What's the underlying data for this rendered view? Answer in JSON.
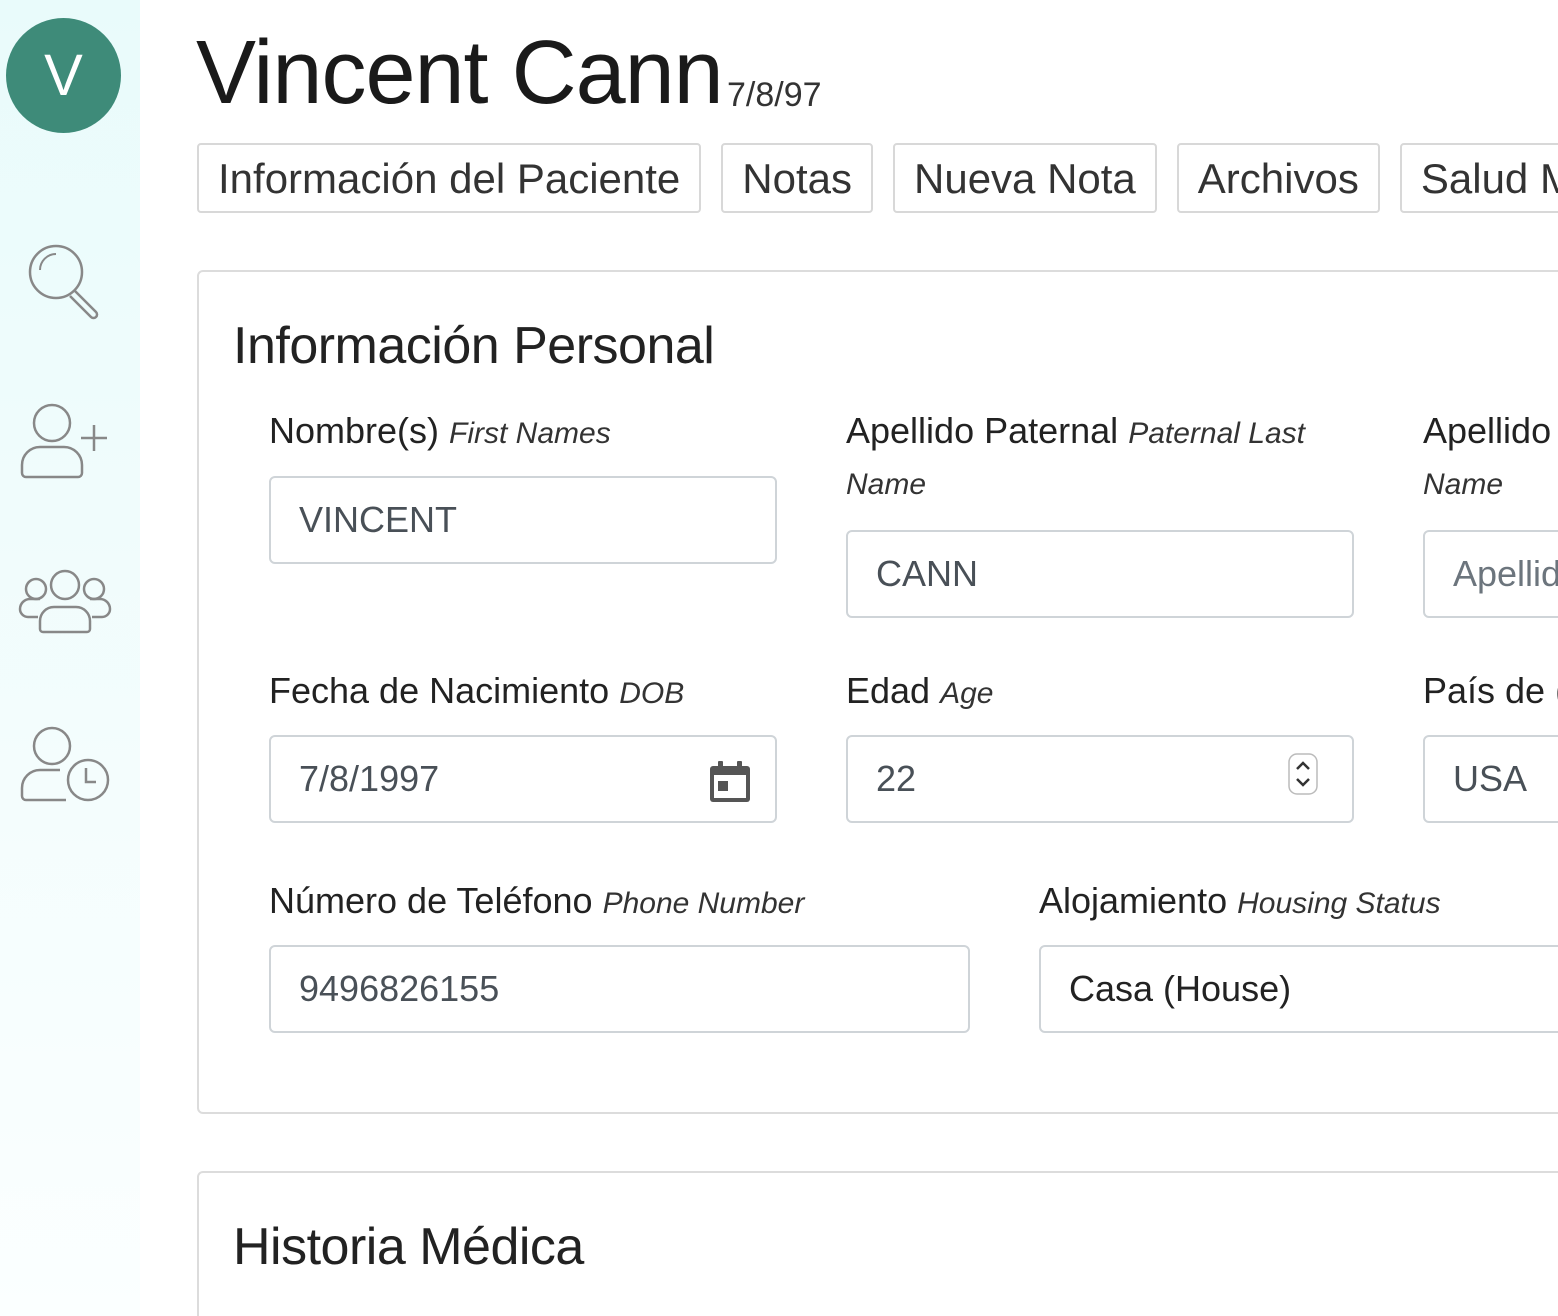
{
  "sidebar": {
    "avatar_initial": "V",
    "items": [
      {
        "icon": "search-icon"
      },
      {
        "icon": "add-user-icon"
      },
      {
        "icon": "users-group-icon"
      },
      {
        "icon": "user-clock-icon"
      }
    ]
  },
  "header": {
    "patient_name": "Vincent Cann",
    "dob_short": "7/8/97"
  },
  "tabs": [
    {
      "label": "Información del Paciente"
    },
    {
      "label": "Notas"
    },
    {
      "label": "Nueva Nota"
    },
    {
      "label": "Archivos"
    },
    {
      "label": "Salud Me"
    }
  ],
  "personal_info": {
    "title": "Información Personal",
    "first_names": {
      "label": "Nombre(s)",
      "label_en": "First Names",
      "value": "VINCENT"
    },
    "paternal_last": {
      "label": "Apellido Paternal",
      "label_en": "Paternal Last",
      "label_en_2": "Name",
      "value": "CANN"
    },
    "maternal_last": {
      "label": "Apellido",
      "label_en_2": "Name",
      "placeholder": "Apellid"
    },
    "dob": {
      "label": "Fecha de Nacimiento",
      "label_en": "DOB",
      "value": "7/8/1997"
    },
    "age": {
      "label": "Edad",
      "label_en": "Age",
      "value": "22"
    },
    "country": {
      "label": "País de (",
      "value": "USA"
    },
    "phone": {
      "label": "Número de Teléfono",
      "label_en": "Phone Number",
      "value": "9496826155"
    },
    "housing": {
      "label": "Alojamiento",
      "label_en": "Housing Status",
      "value": "Casa (House)"
    }
  },
  "medical_history": {
    "title": "Historia Médica"
  },
  "colors": {
    "avatar": "#3e8b79",
    "sidebar_bg": "#e9fbfb",
    "border": "#cfd4d8"
  }
}
